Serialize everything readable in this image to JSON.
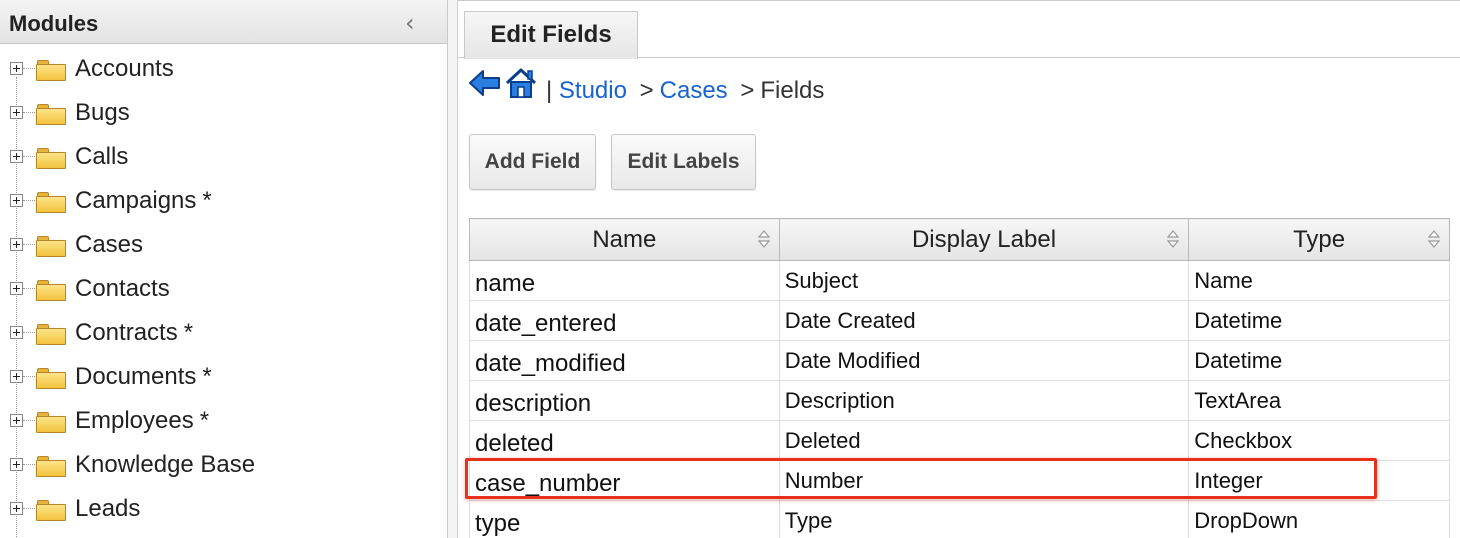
{
  "modules_panel": {
    "title": "Modules",
    "collapse_icon": "chevron-left-icon",
    "items": [
      {
        "label": "Accounts",
        "starred": false
      },
      {
        "label": "Bugs",
        "starred": false
      },
      {
        "label": "Calls",
        "starred": false
      },
      {
        "label": "Campaigns",
        "starred": true
      },
      {
        "label": "Cases",
        "starred": false
      },
      {
        "label": "Contacts",
        "starred": false
      },
      {
        "label": "Contracts",
        "starred": true
      },
      {
        "label": "Documents",
        "starred": true
      },
      {
        "label": "Employees",
        "starred": true
      },
      {
        "label": "Knowledge Base",
        "starred": false
      },
      {
        "label": "Leads",
        "starred": false
      }
    ],
    "star_text": "*"
  },
  "tabs": {
    "active_label": "Edit Fields"
  },
  "breadcrumb": {
    "pipe": "|",
    "studio": "Studio",
    "sep": ">",
    "cases": "Cases",
    "current": "Fields",
    "icons": [
      "back-arrow-icon",
      "home-icon"
    ]
  },
  "toolbar": {
    "add_field": "Add Field",
    "edit_labels": "Edit Labels"
  },
  "fields_table": {
    "headers": [
      "Name",
      "Display Label",
      "Type"
    ],
    "rows": [
      {
        "name": "name",
        "label": "Subject",
        "type": "Name"
      },
      {
        "name": "date_entered",
        "label": "Date Created",
        "type": "Datetime"
      },
      {
        "name": "date_modified",
        "label": "Date Modified",
        "type": "Datetime"
      },
      {
        "name": "description",
        "label": "Description",
        "type": "TextArea"
      },
      {
        "name": "deleted",
        "label": "Deleted",
        "type": "Checkbox"
      },
      {
        "name": "case_number",
        "label": "Number",
        "type": "Integer"
      },
      {
        "name": "type",
        "label": "Type",
        "type": "DropDown"
      }
    ],
    "highlighted_row": 5
  },
  "colors": {
    "link": "#1763d1",
    "highlight": "#e8301c",
    "folder": "#f2c23d"
  }
}
